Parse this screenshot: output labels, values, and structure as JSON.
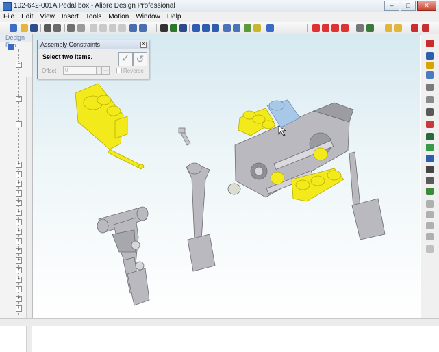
{
  "window": {
    "title": "102-642-001A Pedal box - Alibre Design Professional"
  },
  "menu": [
    "File",
    "Edit",
    "View",
    "Insert",
    "Tools",
    "Motion",
    "Window",
    "Help"
  ],
  "explorer": {
    "title": "Design Exp"
  },
  "dialog": {
    "title": "Assembly Constraints",
    "prompt": "Select two items.",
    "offset_label": "Offset",
    "offset_value": "0",
    "browse_label": "...",
    "reverse_label": "Reverse"
  },
  "colors": {
    "selected_part": "#f2ea1a",
    "highlight_part": "#a8c8e8",
    "part_gray": "#b9b9bf"
  }
}
